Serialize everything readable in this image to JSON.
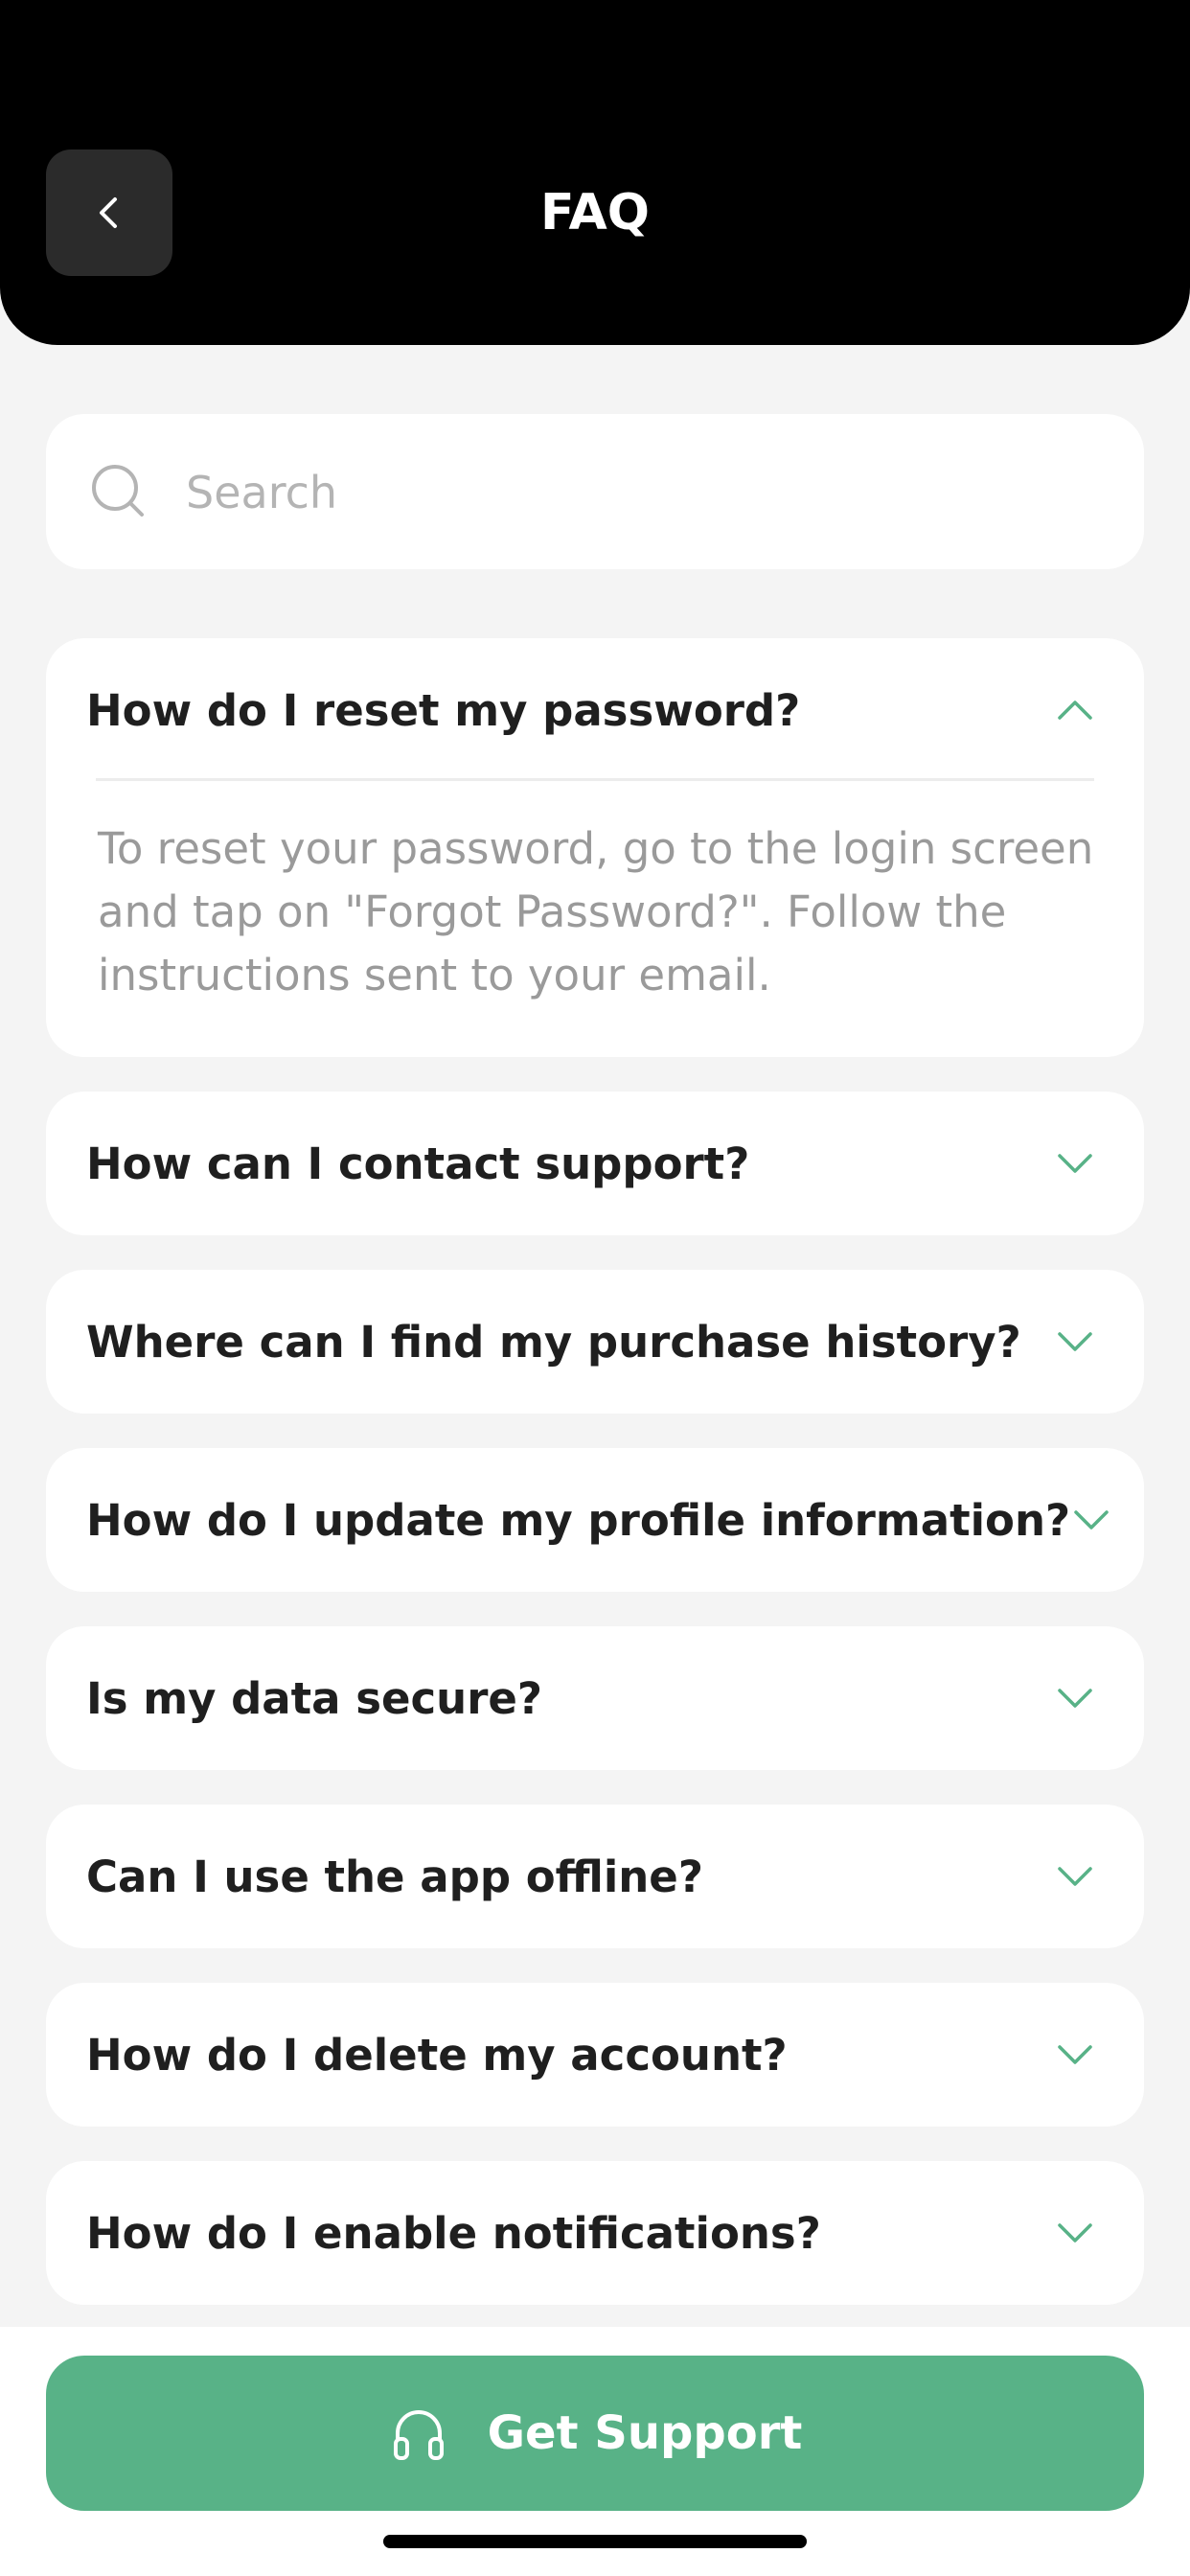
{
  "header": {
    "title": "FAQ",
    "back_icon": "chevron-left-icon"
  },
  "search": {
    "placeholder": "Search",
    "value": "",
    "icon": "search-icon"
  },
  "faqs": [
    {
      "question": "How do I reset my password?",
      "expanded": true,
      "answer": "To reset your password, go to the login screen and tap on \"Forgot Password?\". Follow the instructions sent to your email."
    },
    {
      "question": "How can I contact support?",
      "expanded": false
    },
    {
      "question": "Where can I find my purchase history?",
      "expanded": false
    },
    {
      "question": "How do I update my profile information?",
      "expanded": false
    },
    {
      "question": "Is my data secure?",
      "expanded": false
    },
    {
      "question": "Can I use the app offline?",
      "expanded": false
    },
    {
      "question": "How do I delete my account?",
      "expanded": false
    },
    {
      "question": "How do I enable notifications?",
      "expanded": false
    }
  ],
  "support_button": {
    "label": "Get Support",
    "icon": "headphones-icon"
  },
  "colors": {
    "accent": "#58b287",
    "header_bg": "#000000",
    "page_bg": "#f4f4f4",
    "card_bg": "#ffffff"
  }
}
